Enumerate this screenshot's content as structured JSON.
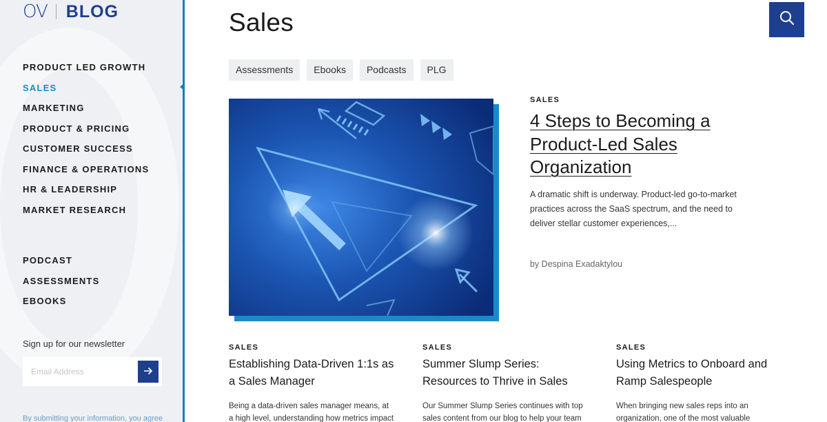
{
  "logo": {
    "mark": "OV",
    "text": "BLOG"
  },
  "sidebar": {
    "categories": [
      {
        "label": "PRODUCT LED GROWTH",
        "active": false
      },
      {
        "label": "SALES",
        "active": true
      },
      {
        "label": "MARKETING",
        "active": false
      },
      {
        "label": "PRODUCT & PRICING",
        "active": false
      },
      {
        "label": "CUSTOMER SUCCESS",
        "active": false
      },
      {
        "label": "FINANCE & OPERATIONS",
        "active": false
      },
      {
        "label": "HR & LEADERSHIP",
        "active": false
      },
      {
        "label": "MARKET RESEARCH",
        "active": false
      }
    ],
    "resources": [
      "PODCAST",
      "ASSESSMENTS",
      "EBOOKS"
    ],
    "newsletter": {
      "label": "Sign up for our newsletter",
      "placeholder": "Email Address",
      "submit_icon": "arrow-right-icon",
      "disclaimer": "By submitting your information, you agree"
    }
  },
  "main": {
    "title": "Sales",
    "search_icon": "search-icon",
    "tags": [
      "Assessments",
      "Ebooks",
      "Podcasts",
      "PLG"
    ],
    "featured": {
      "category": "SALES",
      "title": "4 Steps to Becoming a Product-Led Sales Organization",
      "excerpt": "A dramatic shift is underway. Product-led go-to-market practices across the SaaS spectrum, and the need to deliver stellar customer experiences,...",
      "author": "by Despina Exadaktylou"
    },
    "cards": [
      {
        "category": "SALES",
        "title": "Establishing Data-Driven 1:1s as a Sales Manager",
        "excerpt": "Being a data-driven sales manager means, at a high level, understanding how metrics impact"
      },
      {
        "category": "SALES",
        "title": "Summer Slump Series: Resources to Thrive in Sales",
        "excerpt": "Our Summer Slump Series continues with top sales content from our blog to help your team"
      },
      {
        "category": "SALES",
        "title": "Using Metrics to Onboard and Ramp Salespeople",
        "excerpt": "When bringing new sales reps into an organization, one of the most valuable"
      }
    ]
  },
  "colors": {
    "brand_navy": "#1e3f8f",
    "accent_blue": "#1a8ac7",
    "sidebar_bg": "#eef0f3"
  }
}
